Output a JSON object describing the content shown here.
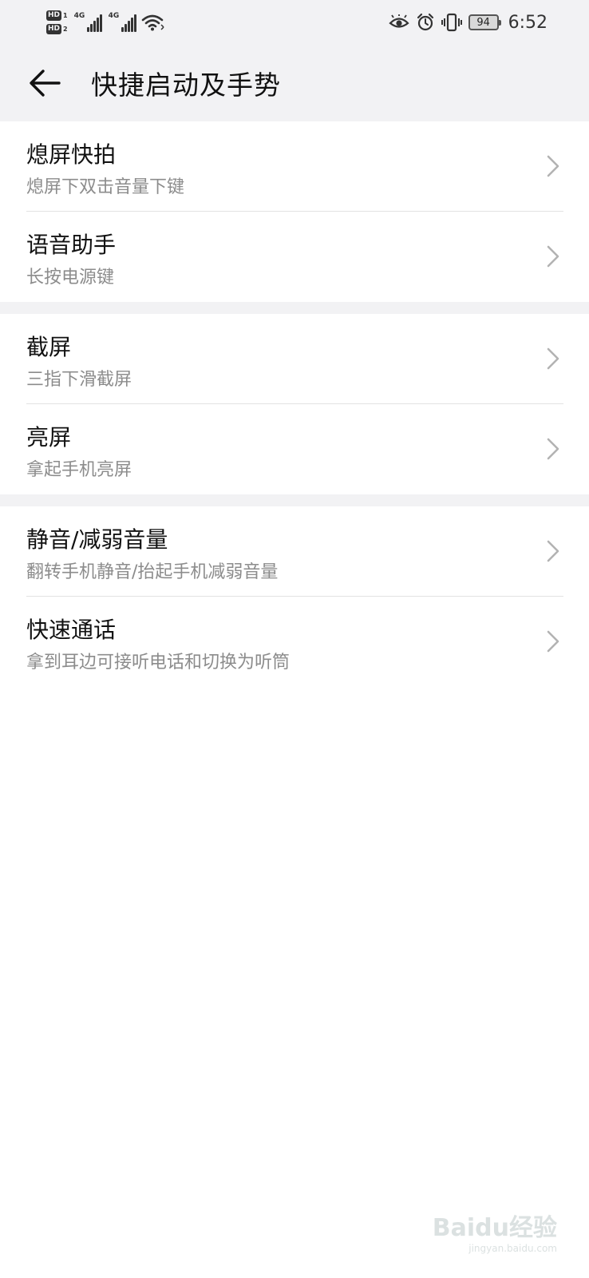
{
  "status_bar": {
    "sim1_label": "HD",
    "sim1_num": "1",
    "sim2_label": "HD",
    "sim2_num": "2",
    "net1": "4G",
    "net2": "4G",
    "battery": "94",
    "time": "6:52"
  },
  "header": {
    "title": "快捷启动及手势"
  },
  "groups": [
    {
      "items": [
        {
          "title": "熄屏快拍",
          "subtitle": "熄屏下双击音量下键"
        },
        {
          "title": "语音助手",
          "subtitle": "长按电源键"
        }
      ]
    },
    {
      "items": [
        {
          "title": "截屏",
          "subtitle": "三指下滑截屏"
        },
        {
          "title": "亮屏",
          "subtitle": "拿起手机亮屏"
        }
      ]
    },
    {
      "items": [
        {
          "title": "静音/减弱音量",
          "subtitle": "翻转手机静音/抬起手机减弱音量"
        },
        {
          "title": "快速通话",
          "subtitle": "拿到耳边可接听电话和切换为听筒"
        }
      ]
    }
  ],
  "watermark": {
    "main": "Baidu经验",
    "sub": "jingyan.baidu.com"
  }
}
